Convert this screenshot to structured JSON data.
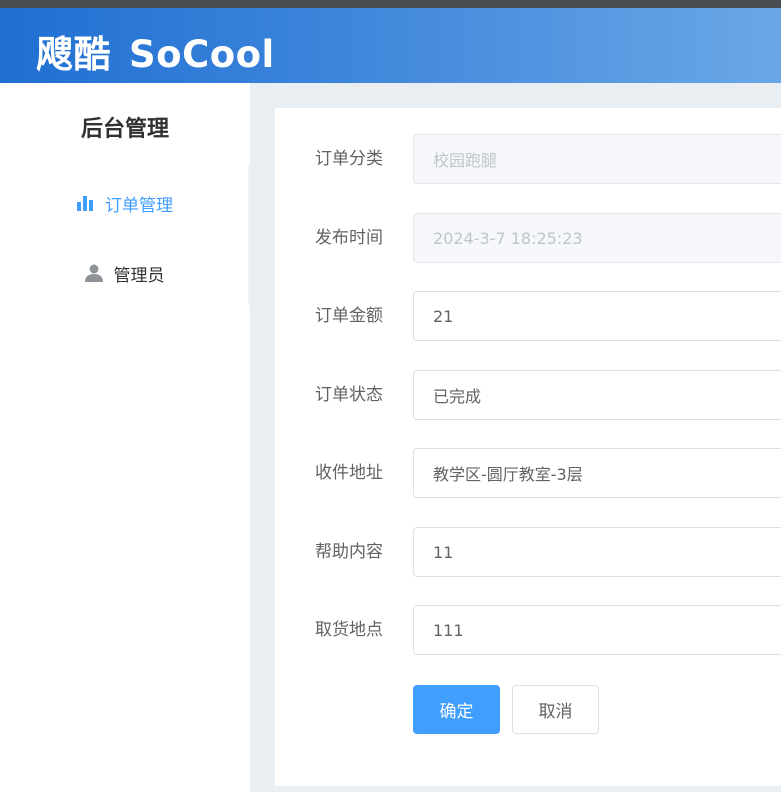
{
  "header": {
    "brand_cn": "飕酷",
    "brand_en": "SoCool"
  },
  "sidebar": {
    "title": "后台管理",
    "items": [
      {
        "label": "订单管理",
        "icon": "bar-chart-icon",
        "active": true
      },
      {
        "label": "管理员",
        "icon": "user-icon",
        "active": false
      }
    ]
  },
  "form": {
    "fields": [
      {
        "label": "订单分类",
        "value": "校园跑腿",
        "disabled": true
      },
      {
        "label": "发布时间",
        "value": "2024-3-7 18:25:23",
        "disabled": true
      },
      {
        "label": "订单金额",
        "value": "21",
        "disabled": false
      },
      {
        "label": "订单状态",
        "value": "已完成",
        "disabled": false
      },
      {
        "label": "收件地址",
        "value": "教学区-圆厅教室-3层",
        "disabled": false
      },
      {
        "label": "帮助内容",
        "value": "11",
        "disabled": false
      },
      {
        "label": "取货地点",
        "value": "111",
        "disabled": false
      }
    ],
    "confirm_label": "确定",
    "cancel_label": "取消"
  },
  "colors": {
    "accent": "#409eff",
    "header_start": "#1f6fd2",
    "header_end": "#6aa7e6"
  }
}
